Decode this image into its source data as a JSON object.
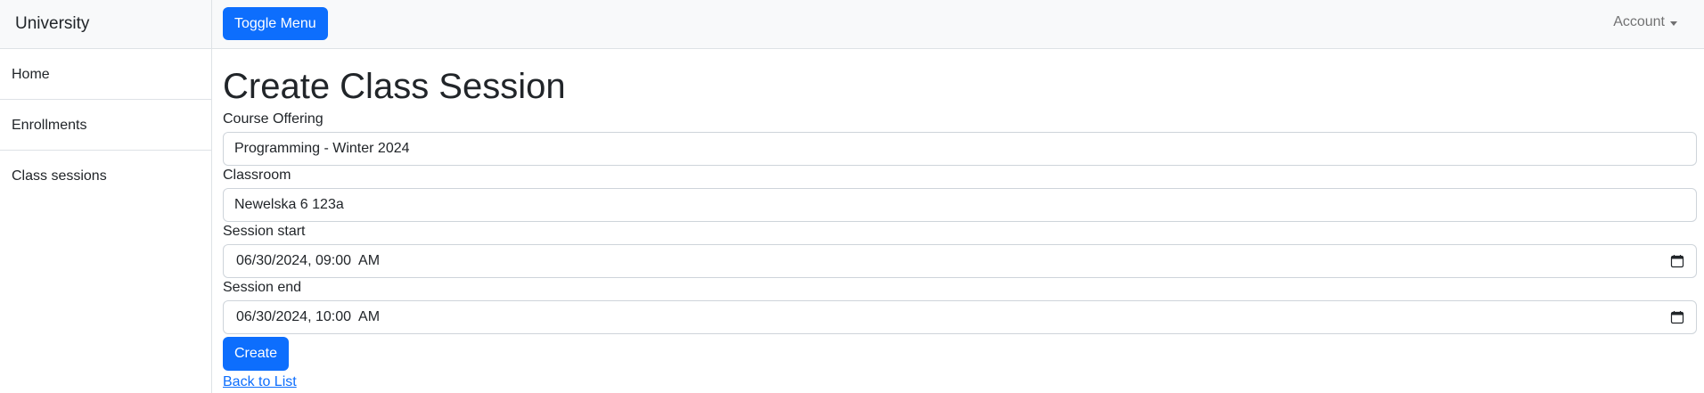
{
  "sidebar": {
    "heading": "University",
    "items": [
      {
        "label": "Home"
      },
      {
        "label": "Enrollments"
      },
      {
        "label": "Class sessions"
      }
    ]
  },
  "topbar": {
    "toggle_label": "Toggle Menu",
    "account_label": "Account"
  },
  "main": {
    "title": "Create Class Session",
    "fields": {
      "course_offering": {
        "label": "Course Offering",
        "value": "Programming - Winter 2024"
      },
      "classroom": {
        "label": "Classroom",
        "value": "Newelska 6 123a"
      },
      "session_start": {
        "label": "Session start",
        "value": "06/30/2024, 09:00  AM"
      },
      "session_end": {
        "label": "Session end",
        "value": "06/30/2024, 10:00  AM"
      }
    },
    "create_label": "Create",
    "back_label": "Back to List"
  },
  "colors": {
    "primary": "#0d6efd",
    "border": "#dee2e6",
    "topbar_bg": "#f8f9fa"
  },
  "icons": [
    "calendar-icon",
    "caret-down-icon"
  ]
}
